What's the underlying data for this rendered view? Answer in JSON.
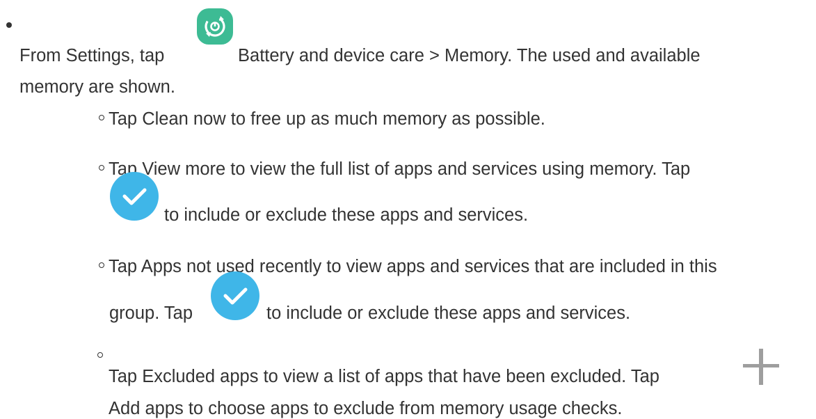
{
  "step": {
    "before_icon": "From Settings, tap",
    "after_icon": "Battery and device care > Memory. The used and available",
    "line2": "memory are shown.",
    "icon": "device-care-icon"
  },
  "sub_items": [
    {
      "text": "Tap Clean now to free up as much memory as possible."
    },
    {
      "line1": "Tap View more to view the full list of apps and services using memory. Tap",
      "line2": "to include or exclude these apps and services.",
      "icon": "checkmark-circle-icon"
    },
    {
      "line1": "Tap Apps not used recently to view apps and services that are included in this",
      "line2_before": "group. Tap",
      "line2_after": "to include or exclude these apps and services.",
      "icon": "checkmark-circle-icon"
    },
    {
      "line1": "Tap Excluded apps to view a list of apps that have been excluded. Tap",
      "line2": "Add apps to choose apps to exclude from memory usage checks.",
      "icon": "plus-icon"
    }
  ],
  "colors": {
    "text": "#333333",
    "device_care_icon": "#3dbb94",
    "check_icon": "#3fb6e8",
    "plus_icon": "#9e9e9e"
  }
}
